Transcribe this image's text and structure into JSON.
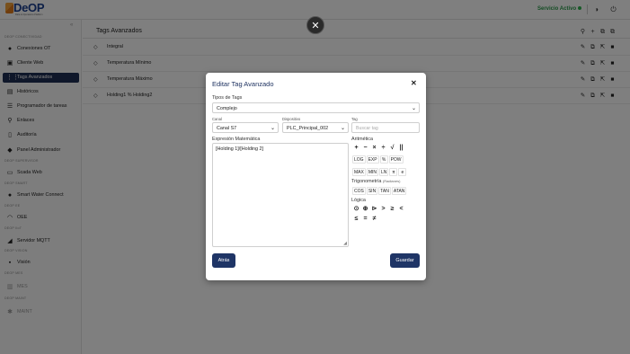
{
  "header": {
    "logo_text": "DeOP",
    "logo_sub": "Data & Operations Platform",
    "service_status": "Servicio Activo",
    "icons": [
      "moon-icon",
      "power-icon"
    ]
  },
  "sidebar": {
    "sections": {
      "conectividad": "DEOP CONECTIVIDAD",
      "supervisor": "DEOP SUPERVISOR",
      "smart": "DEOP SMART",
      "ee": "DEOP EE",
      "iiot": "DEOP IIoT",
      "vision": "DEOP VISION",
      "mes": "DEOP MES",
      "maint": "DEOP MAINT"
    },
    "items": [
      {
        "label": "Conexiones OT"
      },
      {
        "label": "Cliente Web"
      },
      {
        "label": "Tags Avanzados"
      },
      {
        "label": "Históricos"
      },
      {
        "label": "Programador de tareas"
      },
      {
        "label": "Enlaces"
      },
      {
        "label": "Auditoría"
      },
      {
        "label": "Panel Administrador"
      },
      {
        "label": "Scada Web"
      },
      {
        "label": "Smart Water Connect"
      },
      {
        "label": "OEE"
      },
      {
        "label": "Servidor MQTT"
      },
      {
        "label": "Visión"
      },
      {
        "label": "MES"
      },
      {
        "label": "MAINT"
      }
    ]
  },
  "main": {
    "title": "Tags Avanzados",
    "rows": [
      {
        "label": "Integral"
      },
      {
        "label": "Temperatura Mínimo"
      },
      {
        "label": "Temperatura Máximo"
      },
      {
        "label": "Holding1 % Holding2"
      }
    ]
  },
  "modal": {
    "title": "Editar Tag Avanzado",
    "tag_type_label": "Tipos de Tags",
    "tag_type_value": "Complejo",
    "canal_label": "Canal",
    "canal_value": "Canal S7",
    "dispositivo_label": "Dispositivo",
    "dispositivo_value": "PLC_Principal_002",
    "tag_label": "Tag",
    "tag_placeholder": "Buscar tag",
    "expression_label": "Expresión Matemática",
    "expression_value": "[Holding 1]/[Holding 2]",
    "arithmetic_label": "Aritmética",
    "arithmetic_ops": [
      "+",
      "−",
      "×",
      "÷",
      "√",
      "||"
    ],
    "functions_row1": [
      "LOG",
      "EXP",
      "%",
      "POW"
    ],
    "functions_row2": [
      "MAX",
      "MIN",
      "LN",
      "π",
      "e"
    ],
    "trig_label": "Trigonometría",
    "trig_units": "(Radianes)",
    "trig_ops": [
      "COS",
      "SIN",
      "TAN",
      "ATAN"
    ],
    "logic_label": "Lógica",
    "logic_row1": [
      "⊙",
      "⊕",
      "⊳",
      ">",
      "≥",
      "<"
    ],
    "logic_row2": [
      "≤",
      "=",
      "≠"
    ],
    "cancel_label": "Atrás",
    "save_label": "Guardar"
  }
}
